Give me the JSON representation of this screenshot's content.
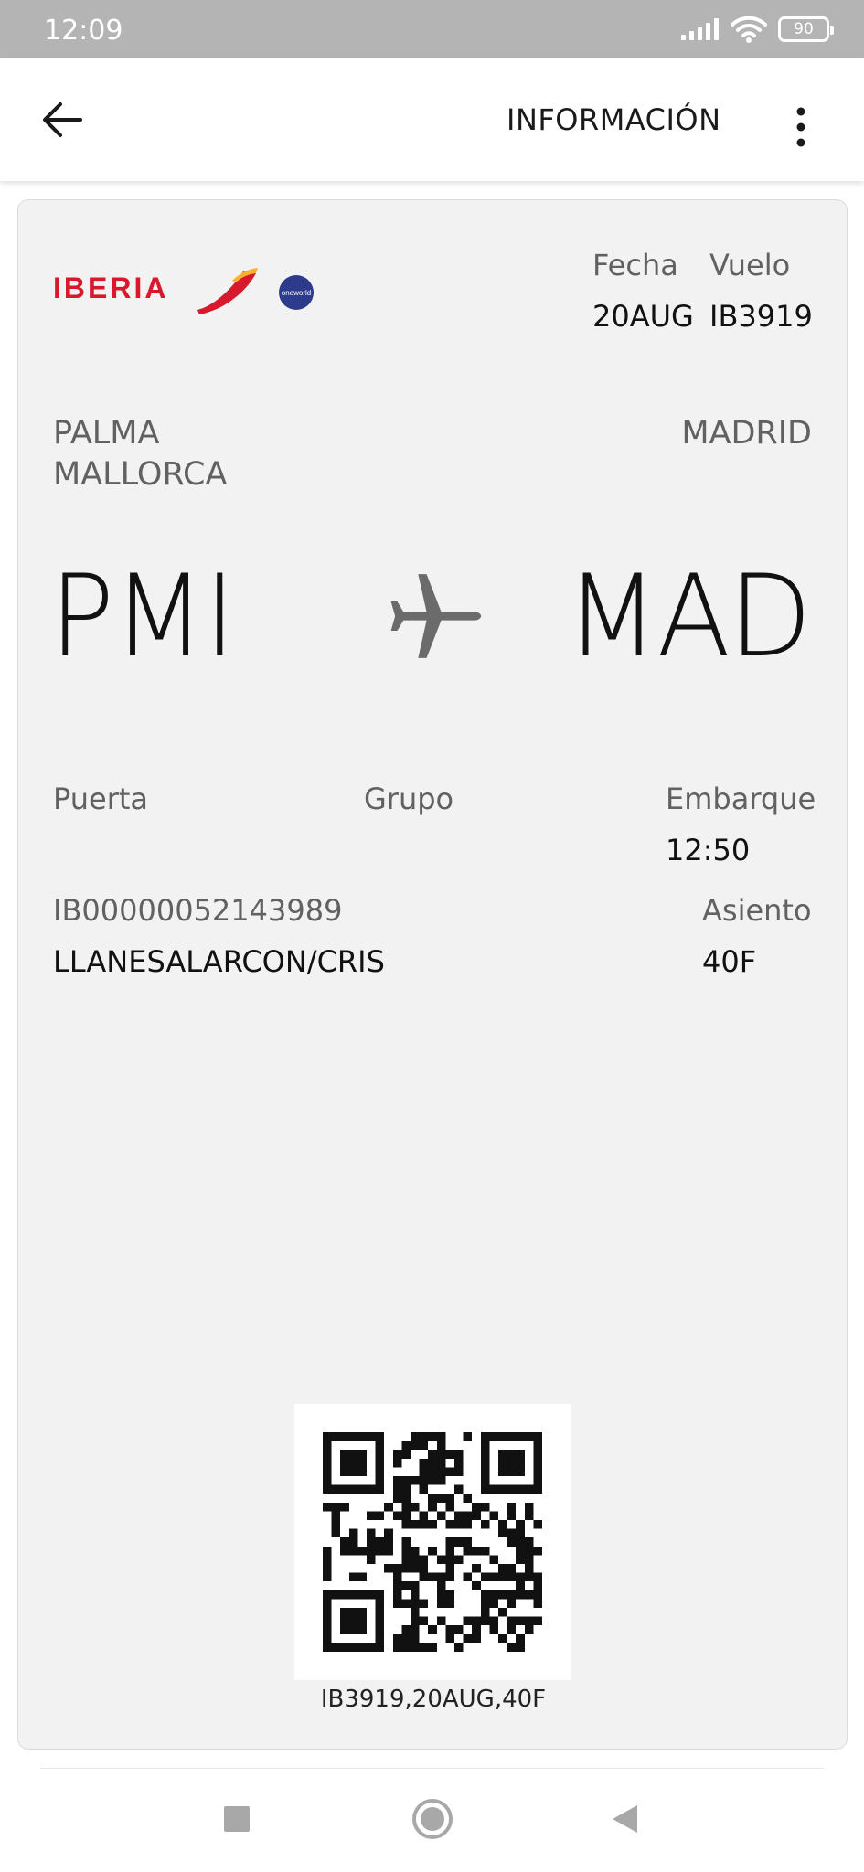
{
  "status_bar": {
    "time": "12:09",
    "battery": "90",
    "icons": [
      "signal-icon",
      "wifi-icon",
      "battery-icon"
    ]
  },
  "app_bar": {
    "title": "INFORMACIÓN",
    "back_icon": "arrow-left-icon",
    "menu_icon": "more-vert-icon"
  },
  "pass": {
    "airline_logo": "IBERIA",
    "alliance_logo": "oneworld",
    "date_label": "Fecha",
    "date_value": "20AUG",
    "flight_label": "Vuelo",
    "flight_value": "IB3919",
    "origin_city_line1": "PALMA",
    "origin_city_line2": "MALLORCA",
    "destination_city": "MADRID",
    "origin_code": "PMI",
    "destination_code": "MAD",
    "plane_icon": "airplane-icon",
    "gate_label": "Puerta",
    "group_label": "Grupo",
    "boarding_label": "Embarque",
    "boarding_time": "12:50",
    "booking_ref": "IB00000052143989",
    "passenger_name": "LLANESALARCON/CRIS",
    "seat_label": "Asiento",
    "seat_value": "40F",
    "qr_caption": "IB3919,20AUG,40F"
  },
  "nav": {
    "icons": [
      "recents-square-icon",
      "home-circle-icon",
      "back-triangle-icon"
    ]
  },
  "colors": {
    "status_bar": "#b4b4b4",
    "card_bg": "#f2f2f2",
    "iberia_red": "#d7192d",
    "iberia_yellow": "#f7b32b",
    "oneworld_blue": "#2e3a8c"
  }
}
